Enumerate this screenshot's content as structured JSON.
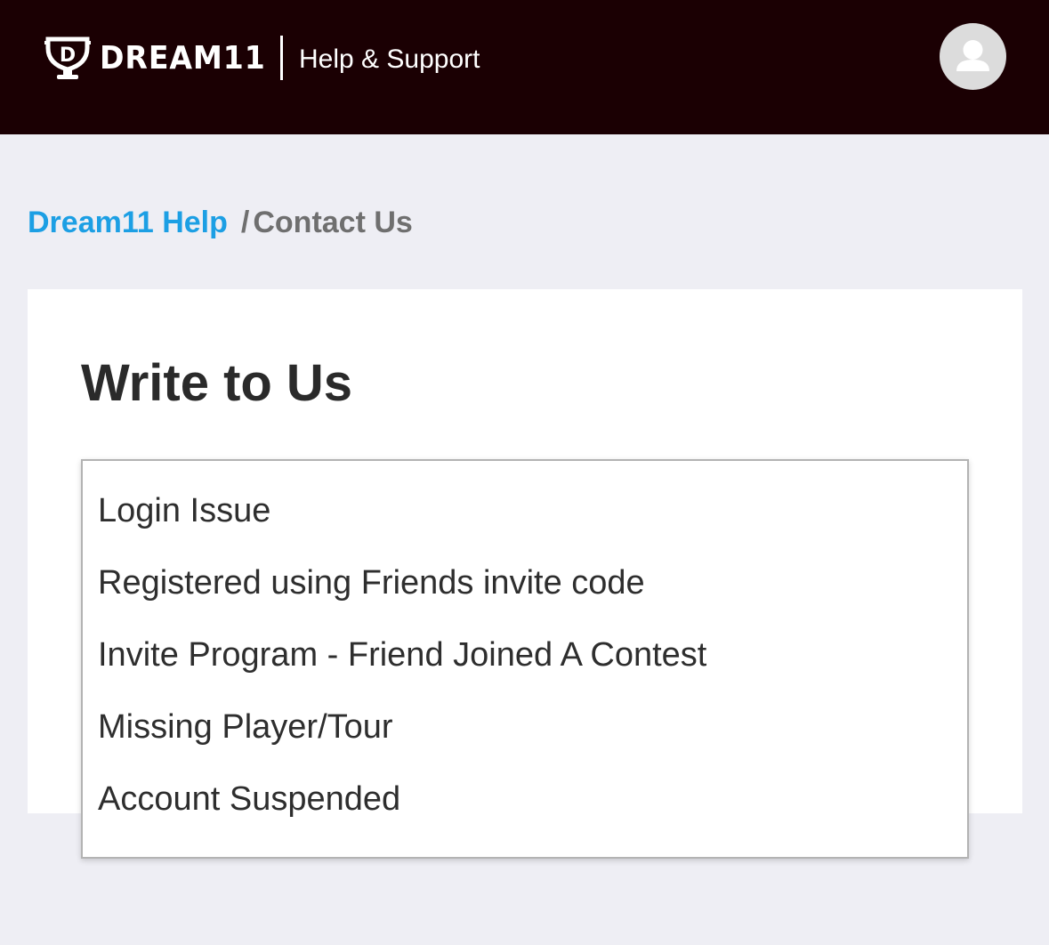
{
  "header": {
    "logo_text": "DREAM11",
    "logo_mark_letter": "D",
    "title": "Help & Support",
    "background_color": "#1b0003",
    "profile_icon": "user-avatar-icon"
  },
  "breadcrumb": {
    "link_label": "Dream11 Help",
    "separator": "/",
    "current_label": "Contact Us",
    "link_color": "#1c9fe4"
  },
  "main": {
    "title": "Write to Us",
    "dropdown": {
      "options": [
        "Login Issue",
        "Registered using Friends invite code",
        "Invite Program - Friend Joined A Contest",
        "Missing Player/Tour",
        "Account Suspended"
      ]
    }
  }
}
